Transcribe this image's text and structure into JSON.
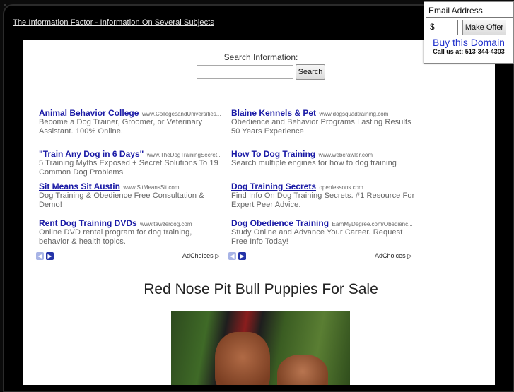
{
  "site": {
    "title": "The Information Factor - Information On Several Subjects"
  },
  "search": {
    "label": "Search Information:",
    "placeholder": "",
    "button": "Search"
  },
  "ads": {
    "left": [
      {
        "title": "Animal Behavior College",
        "url": "www.CollegesandUniversities...",
        "text": "Become a Dog Trainer, Groomer, or Veterinary Assistant. 100% Online."
      },
      {
        "title": "\"Train Any Dog in 6 Days\"",
        "url": "www.TheDogTrainingSecret...",
        "text": "5 Training Myths Exposed + Secret Solutions To 19 Common Dog Problems"
      },
      {
        "title": "Sit Means Sit Austin",
        "url": "www.SitMeansSit.com",
        "text": "Dog Training & Obedience Free Consultation & Demo!"
      },
      {
        "title": "Rent Dog Training DVDs",
        "url": "www.tawzerdog.com",
        "text": "Online DVD rental program for dog training, behavior & health topics."
      }
    ],
    "right": [
      {
        "title": "Blaine Kennels & Pet",
        "url": "www.dogsquadtraining.com",
        "text": "Obedience and Behavior Programs Lasting Results 50 Years Experience"
      },
      {
        "title": "How To Dog Training",
        "url": "www.webcrawler.com",
        "text": "Search multiple engines for how to dog training"
      },
      {
        "title": "Dog Training Secrets",
        "url": "openlessons.com",
        "text": "Find Info On Dog Training Secrets. #1 Resource For Expert Peer Advice."
      },
      {
        "title": "Dog Obedience Training",
        "url": "EarnMyDegree.com/Obedienc...",
        "text": "Study Online and Advance Your Career. Request Free Info Today!"
      }
    ],
    "adchoices": "AdChoices ▷",
    "prev_icon": "chevron-left-icon",
    "next_icon": "chevron-right-icon"
  },
  "main": {
    "heading": "Red Nose Pit Bull Puppies For Sale"
  },
  "offer": {
    "email_value": "Email Address",
    "currency": "$",
    "button": "Make Offer",
    "buy_link": "Buy this Domain",
    "call": "Call us at: 513-344-4303"
  }
}
